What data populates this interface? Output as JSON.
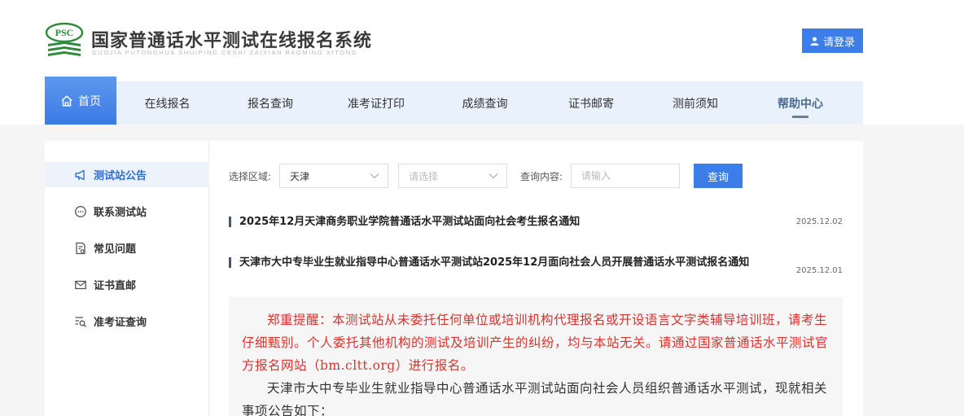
{
  "header": {
    "logo_text": "PSC",
    "title": "国家普通话水平测试在线报名系统",
    "subtitle": "GUOJIA PUTONGHUA SHUIPING CESHI ZAIXIAN BAOMING XITONG",
    "login_label": "请登录"
  },
  "nav": {
    "items": [
      {
        "label": "首页"
      },
      {
        "label": "在线报名"
      },
      {
        "label": "报名查询"
      },
      {
        "label": "准考证打印"
      },
      {
        "label": "成绩查询"
      },
      {
        "label": "证书邮寄"
      },
      {
        "label": "测前须知"
      },
      {
        "label": "帮助中心"
      }
    ]
  },
  "sidebar": {
    "items": [
      {
        "label": "测试站公告",
        "icon": "megaphone-icon"
      },
      {
        "label": "联系测试站",
        "icon": "chat-icon"
      },
      {
        "label": "常见问题",
        "icon": "document-question-icon"
      },
      {
        "label": "证书直邮",
        "icon": "mail-icon"
      },
      {
        "label": "准考证查询",
        "icon": "list-search-icon"
      }
    ]
  },
  "filters": {
    "region_label": "选择区域:",
    "region_value": "天津",
    "sub_placeholder": "请选择",
    "query_label": "查询内容:",
    "query_placeholder": "请输入",
    "query_button": "查询"
  },
  "notices": [
    {
      "title": "2025年12月天津商务职业学院普通话水平测试站面向社会考生报名通知",
      "date": "2025.12.02"
    },
    {
      "title": "天津市大中专毕业生就业指导中心普通话水平测试站2025年12月面向社会人员开展普通话水平测试报名通知",
      "date": "2025.12.01"
    }
  ],
  "content": {
    "warning": "郑重提醒：本测试站从未委托任何单位或培训机构代理报名或开设语言文字类辅导培训班，请考生仔细甄别。个人委托其他机构的测试及培训产生的纠纷，均与本站无关。请通过国家普通话水平测试官方报名网站（bm.cltt.org）进行报名。",
    "intro": "天津市大中专毕业生就业指导中心普通话水平测试站面向社会人员组织普通话水平测试，现就相关事项公告如下："
  },
  "colors": {
    "accent": "#3d7de8",
    "nav_bg": "#e9f1fc",
    "warning_text": "#d9332e",
    "logo_green": "#2e8b3c"
  }
}
